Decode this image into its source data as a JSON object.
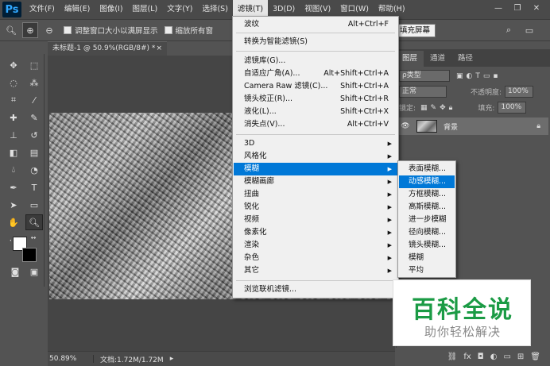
{
  "app": {
    "logo": "Ps"
  },
  "menubar": {
    "items": [
      "文件(F)",
      "编辑(E)",
      "图像(I)",
      "图层(L)",
      "文字(Y)",
      "选择(S)",
      "滤镜(T)",
      "3D(D)",
      "视图(V)",
      "窗口(W)",
      "帮助(H)"
    ],
    "active_index": 6
  },
  "options_bar": {
    "resize_label": "调整窗口大小以满屏显示",
    "zoom_all_label": "缩放所有窗",
    "fill_screen_label": "填充屏幕"
  },
  "document": {
    "tab_title": "未标题-1 @ 50.9%(RGB/8#) *",
    "zoom": "50.89%",
    "doc_info": "文档:1.72M/1.72M"
  },
  "filter_menu": {
    "items": [
      {
        "label": "波纹",
        "shortcut": "Alt+Ctrl+F"
      },
      {
        "label": "转换为智能滤镜(S)"
      },
      {
        "label": "滤镜库(G)..."
      },
      {
        "label": "自适应广角(A)...",
        "shortcut": "Alt+Shift+Ctrl+A"
      },
      {
        "label": "Camera Raw 滤镜(C)...",
        "shortcut": "Shift+Ctrl+A"
      },
      {
        "label": "镜头校正(R)...",
        "shortcut": "Shift+Ctrl+R"
      },
      {
        "label": "液化(L)...",
        "shortcut": "Shift+Ctrl+X"
      },
      {
        "label": "消失点(V)...",
        "shortcut": "Alt+Ctrl+V"
      },
      {
        "label": "3D"
      },
      {
        "label": "风格化"
      },
      {
        "label": "模糊"
      },
      {
        "label": "模糊画廊"
      },
      {
        "label": "扭曲"
      },
      {
        "label": "锐化"
      },
      {
        "label": "视频"
      },
      {
        "label": "像素化"
      },
      {
        "label": "渲染"
      },
      {
        "label": "杂色"
      },
      {
        "label": "其它"
      },
      {
        "label": "浏览联机滤镜..."
      }
    ]
  },
  "blur_submenu": {
    "items": [
      "表面模糊...",
      "动感模糊...",
      "方框模糊...",
      "高斯模糊...",
      "进一步模糊",
      "径向模糊...",
      "镜头模糊...",
      "模糊",
      "平均"
    ],
    "highlighted_index": 1
  },
  "layers_panel": {
    "tabs": [
      "图层",
      "通道",
      "路径"
    ],
    "kind_label": "ρ类型",
    "blend_mode": "正常",
    "opacity_label": "不透明度:",
    "opacity_value": "100%",
    "lock_label": "锁定:",
    "fill_label": "填充:",
    "fill_value": "100%",
    "layer_name": "背景"
  },
  "watermark": {
    "title": "百科全说",
    "subtitle": "助你轻松解决"
  }
}
